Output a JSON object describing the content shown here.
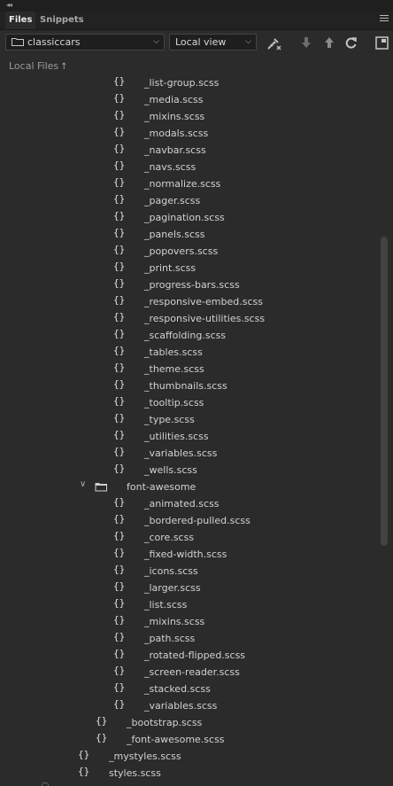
{
  "window": {
    "collapse_glyph": "◂◂"
  },
  "tabs": [
    {
      "label": "Files"
    },
    {
      "label": "Snippets"
    }
  ],
  "toolbar": {
    "site": "classiccars",
    "view": "Local view",
    "icons": [
      "connect-icon",
      "get-icon",
      "put-icon",
      "refresh-icon",
      "expand-icon"
    ]
  },
  "header": {
    "label": "Local Files",
    "sort_glyph": "🠕"
  },
  "tree": {
    "bootstrap_files": [
      "_list-group.scss",
      "_media.scss",
      "_mixins.scss",
      "_modals.scss",
      "_navbar.scss",
      "_navs.scss",
      "_normalize.scss",
      "_pager.scss",
      "_pagination.scss",
      "_panels.scss",
      "_popovers.scss",
      "_print.scss",
      "_progress-bars.scss",
      "_responsive-embed.scss",
      "_responsive-utilities.scss",
      "_scaffolding.scss",
      "_tables.scss",
      "_theme.scss",
      "_thumbnails.scss",
      "_tooltip.scss",
      "_type.scss",
      "_utilities.scss",
      "_variables.scss",
      "_wells.scss"
    ],
    "folder": "font-awesome",
    "font_awesome_files": [
      "_animated.scss",
      "_bordered-pulled.scss",
      "_core.scss",
      "_fixed-width.scss",
      "_icons.scss",
      "_larger.scss",
      "_list.scss",
      "_mixins.scss",
      "_path.scss",
      "_rotated-flipped.scss",
      "_screen-reader.scss",
      "_stacked.scss",
      "_variables.scss"
    ],
    "parent_files": [
      "_bootstrap.scss",
      "_font-awesome.scss"
    ],
    "root_files": [
      "_mystyles.scss",
      "styles.scss"
    ],
    "file_glyph": "{}"
  }
}
